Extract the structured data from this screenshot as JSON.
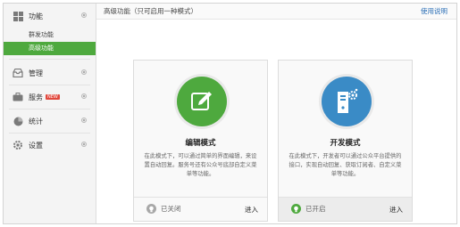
{
  "header": {
    "title": "高级功能（只可启用一种模式）",
    "help_link": "使用说明"
  },
  "sidebar": {
    "groups": [
      {
        "label": "功能",
        "icon": "grid-icon",
        "subitems": [
          "群发功能",
          "高级功能"
        ],
        "active_subitem": "高级功能"
      },
      {
        "label": "管理",
        "icon": "inbox-icon"
      },
      {
        "label": "服务",
        "icon": "briefcase-icon",
        "badge": "NEW"
      },
      {
        "label": "统计",
        "icon": "pie-chart-icon"
      },
      {
        "label": "设置",
        "icon": "gear-icon"
      }
    ]
  },
  "cards": [
    {
      "title": "编辑模式",
      "description": "在此模式下，可以通过简单的界面编辑，来设置自动回复。服务号还有公众号底部自定义菜单等功能。",
      "status": "已关闭",
      "action": "进入",
      "icon": "edit-pencil-icon",
      "status_icon": "bulb-off-icon",
      "accent": "#4ea93e"
    },
    {
      "title": "开发模式",
      "description": "在此模式下，开发者可以通过公众平台提供的接口，实现自动回复、获取订阅者、自定义菜单等功能。",
      "status": "已开启",
      "action": "进入",
      "icon": "server-gear-icon",
      "status_icon": "bulb-on-icon",
      "accent": "#3a8bc6"
    }
  ]
}
